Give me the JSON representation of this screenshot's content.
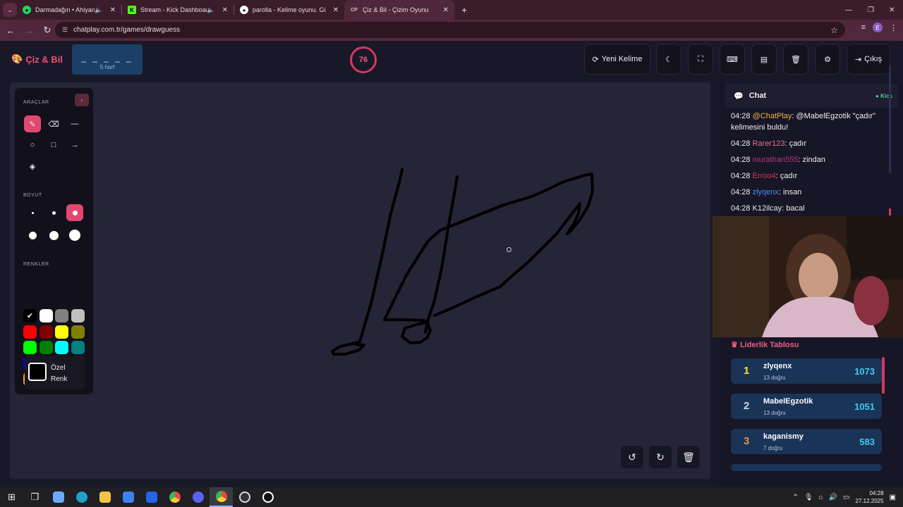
{
  "browser": {
    "tabs": [
      {
        "title": "Darmadağın • Ahiyan",
        "audio": true
      },
      {
        "title": "Stream - Kick Dashboard",
        "audio": true
      },
      {
        "title": "parolla - Kelime oyunu. Günlük",
        "audio": false
      },
      {
        "title": "Çiz & Bil - Çizim Oyunu",
        "audio": false,
        "favicon_text": "CP"
      }
    ],
    "url": "chatplay.com.tr/games/drawguess",
    "profile_initial": "E"
  },
  "game": {
    "logo": "Çiz & Bil",
    "word_blanks": "_ _ _ _ _",
    "word_length": "5 harf",
    "timer": "76",
    "new_word_label": "Yeni Kelime",
    "exit_label": "Çıkış"
  },
  "toolbox": {
    "tools_heading": "ARAÇLAR",
    "size_heading": "BOYUT",
    "colors_heading": "RENKLER",
    "custom_color_line1": "Özel",
    "custom_color_line2": "Renk",
    "colors": [
      "#000000",
      "#ffffff",
      "#808080",
      "#c0c0c0",
      "#ff0000",
      "#800000",
      "#ffff00",
      "#808000",
      "#00ff00",
      "#008000",
      "#00ffff",
      "#008080",
      "#0000ff",
      "#000080",
      "#ff00ff",
      "#800080",
      "#ff9f00",
      "#b0202f",
      "#f4a6b4",
      "#ffd700"
    ],
    "selected_color": "#000000"
  },
  "chat": {
    "title": "Chat",
    "platform": "Kick",
    "messages": [
      {
        "time": "04:28",
        "user": "@ChatPlay",
        "user_color": "#f0b24a",
        "text": ": @MabelEgzotik \"çadır\" kelimesini buldu!"
      },
      {
        "time": "04:28",
        "user": "Rarer123",
        "user_color": "#e86d92",
        "text": ": çadır"
      },
      {
        "time": "04:28",
        "user": "murathan555",
        "user_color": "#b23a86",
        "text": ": zindan"
      },
      {
        "time": "04:28",
        "user": "Erroo4",
        "user_color": "#d63a52",
        "text": ": çadır"
      },
      {
        "time": "04:28",
        "user": "zlyqenx",
        "user_color": "#4e8ef5",
        "text": ": insan"
      },
      {
        "time": "04:28",
        "user": "K12ilcay",
        "user_color": "#e8e8f0",
        "text": ": bacal"
      }
    ]
  },
  "leaderboard": {
    "title": "Liderlik Tablosu",
    "rows": [
      {
        "rank": "1",
        "rank_color": "#ffd83a",
        "name": "zlyqenx",
        "correct": "13 doğru",
        "score": "1073"
      },
      {
        "rank": "2",
        "rank_color": "#d0d6e0",
        "name": "MabelEgzotik",
        "correct": "13 doğru",
        "score": "1051"
      },
      {
        "rank": "3",
        "rank_color": "#e8913a",
        "name": "kaganismy",
        "correct": "7 doğru",
        "score": "583"
      }
    ]
  },
  "taskbar": {
    "time": "04:28",
    "date": "27.12.2025"
  }
}
